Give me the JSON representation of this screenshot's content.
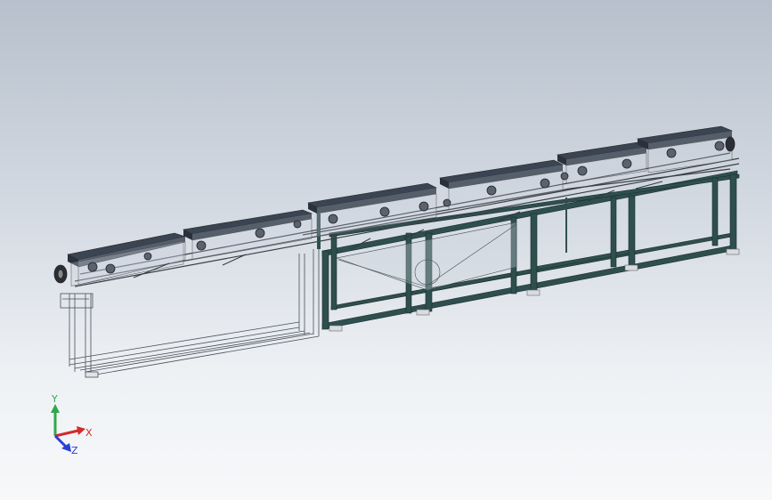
{
  "viewport": {
    "colors": {
      "frame_fill": "#2f4f4f",
      "frame_stroke": "#1c2e2e",
      "conveyor_top": "#3b4452",
      "wire": "#3a3f47",
      "glass": "#c9d1da"
    }
  },
  "triad": {
    "x_label": "X",
    "y_label": "Y",
    "z_label": "Z",
    "x_color": "#d42a2a",
    "y_color": "#2fa84a",
    "z_color": "#2a3fd4"
  }
}
